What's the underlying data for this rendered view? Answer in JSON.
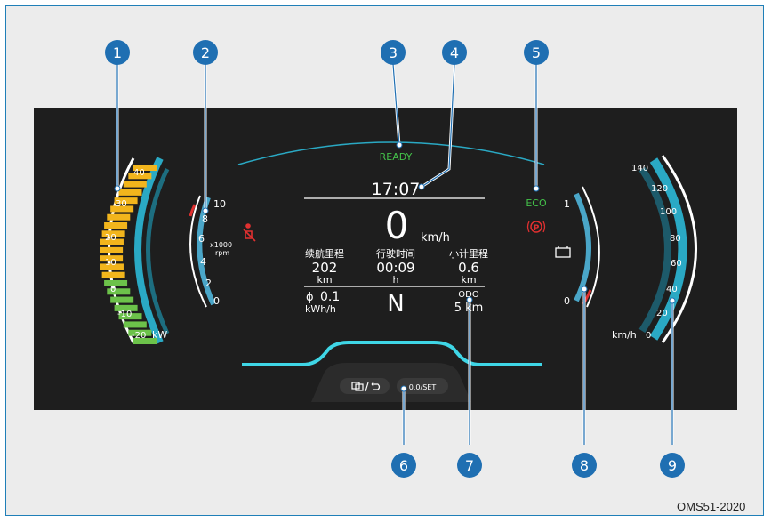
{
  "colors": {
    "callout": "#1f6fb2",
    "dash_bg": "#1e1e1e",
    "accent_cyan": "#3fd6e6",
    "green_text": "#44c24a",
    "red": "#e03030",
    "power_yellow": "#f2b51c",
    "power_green": "#6cc24a"
  },
  "callouts": [
    "1",
    "2",
    "3",
    "4",
    "5",
    "6",
    "7",
    "8",
    "9"
  ],
  "power_gauge": {
    "ticks": [
      "40",
      "30",
      "20",
      "10",
      "0",
      "-10",
      "-20"
    ],
    "unit": "kW"
  },
  "rpm_gauge": {
    "ticks": [
      "10",
      "8",
      "6",
      "4",
      "2",
      "0"
    ],
    "unit_top": "x1000",
    "unit_bottom": "rpm"
  },
  "status": {
    "ready": "READY",
    "time": "17:07",
    "eco": "ECO"
  },
  "speed": {
    "value": "0",
    "unit": "km/h"
  },
  "info": {
    "range_label": "续航里程",
    "range_value": "202",
    "range_unit": "km",
    "drive_time_label": "行驶时间",
    "drive_time_value": "00:09",
    "drive_time_unit": "h",
    "trip_label": "小计里程",
    "trip_value": "0.6",
    "trip_unit": "km",
    "consumption_symbol": "ϕ",
    "consumption_value": "0.1",
    "consumption_unit": "kWh/h",
    "gear": "N",
    "odo_label": "ODO",
    "odo_value": "5 km"
  },
  "battery_gauge": {
    "top": "1",
    "bottom": "0"
  },
  "speed_gauge": {
    "ticks": [
      "140",
      "120",
      "100",
      "80",
      "60",
      "40",
      "20",
      "0"
    ],
    "unit": "km/h"
  },
  "buttons": {
    "mode_icon": "display-mode-icon",
    "reset_label": "0.0/SET"
  },
  "figure_code": "OMS51-2020"
}
